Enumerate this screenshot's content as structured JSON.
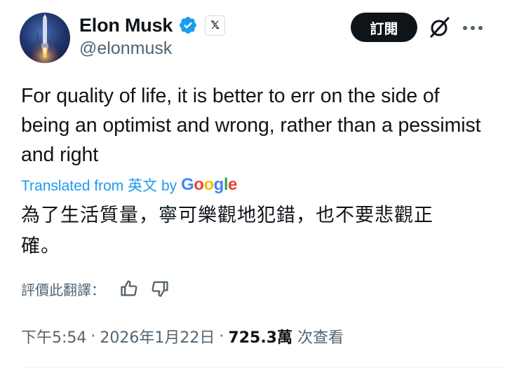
{
  "author": {
    "name": "Elon Musk",
    "handle": "@elonmusk",
    "avatar_icon": "rocket-launch-avatar",
    "verified_color": "#1d9bf0"
  },
  "header": {
    "subscribe_label": "訂閱",
    "grok_icon": "grok-icon",
    "more_icon": "more-dots-icon"
  },
  "tweet": {
    "text": "For quality of life, it is better to err on the side of being an optimist and wrong, rather than a pessimist and right",
    "translated_prefix": "Translated from 英文 by",
    "translation_provider": "Google",
    "translated_text": "為了生活質量，寧可樂觀地犯錯，也不要悲觀正確。"
  },
  "rating": {
    "label": "評價此翻譯：",
    "like_icon": "thumbs-up-icon",
    "dislike_icon": "thumbs-down-icon"
  },
  "meta": {
    "time": "下午5:54",
    "separator": "·",
    "date": "2026年1月22日",
    "views_count": "725.3萬",
    "views_label": "次查看"
  },
  "colors": {
    "accent": "#1d9bf0",
    "text_primary": "#0f1419",
    "text_secondary": "#536471"
  }
}
